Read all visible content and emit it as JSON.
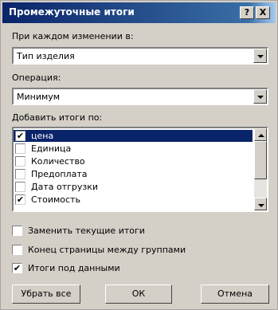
{
  "window": {
    "title": "Промежуточные итоги",
    "help_label": "?",
    "close_label": "X"
  },
  "group_by": {
    "label": "При каждом изменении в:",
    "value": "Тип изделия"
  },
  "operation": {
    "label": "Операция:",
    "value": "Минимум"
  },
  "add_totals": {
    "label": "Добавить итоги по:",
    "items": [
      {
        "label": "цена",
        "checked": true,
        "selected": true
      },
      {
        "label": "Единица",
        "checked": false,
        "selected": false
      },
      {
        "label": "Количество",
        "checked": false,
        "selected": false
      },
      {
        "label": "Предоплата",
        "checked": false,
        "selected": false
      },
      {
        "label": "Дата отгрузки",
        "checked": false,
        "selected": false
      },
      {
        "label": "Стоимость",
        "checked": true,
        "selected": false
      }
    ]
  },
  "options": {
    "replace_current": {
      "label": "Заменить текущие итоги",
      "checked": false
    },
    "page_break": {
      "label": "Конец страницы между группами",
      "checked": false
    },
    "summary_below": {
      "label": "Итоги под данными",
      "checked": true
    }
  },
  "buttons": {
    "remove_all": "Убрать все",
    "ok": "ОК",
    "cancel": "Отмена"
  },
  "check_glyph": "✔"
}
